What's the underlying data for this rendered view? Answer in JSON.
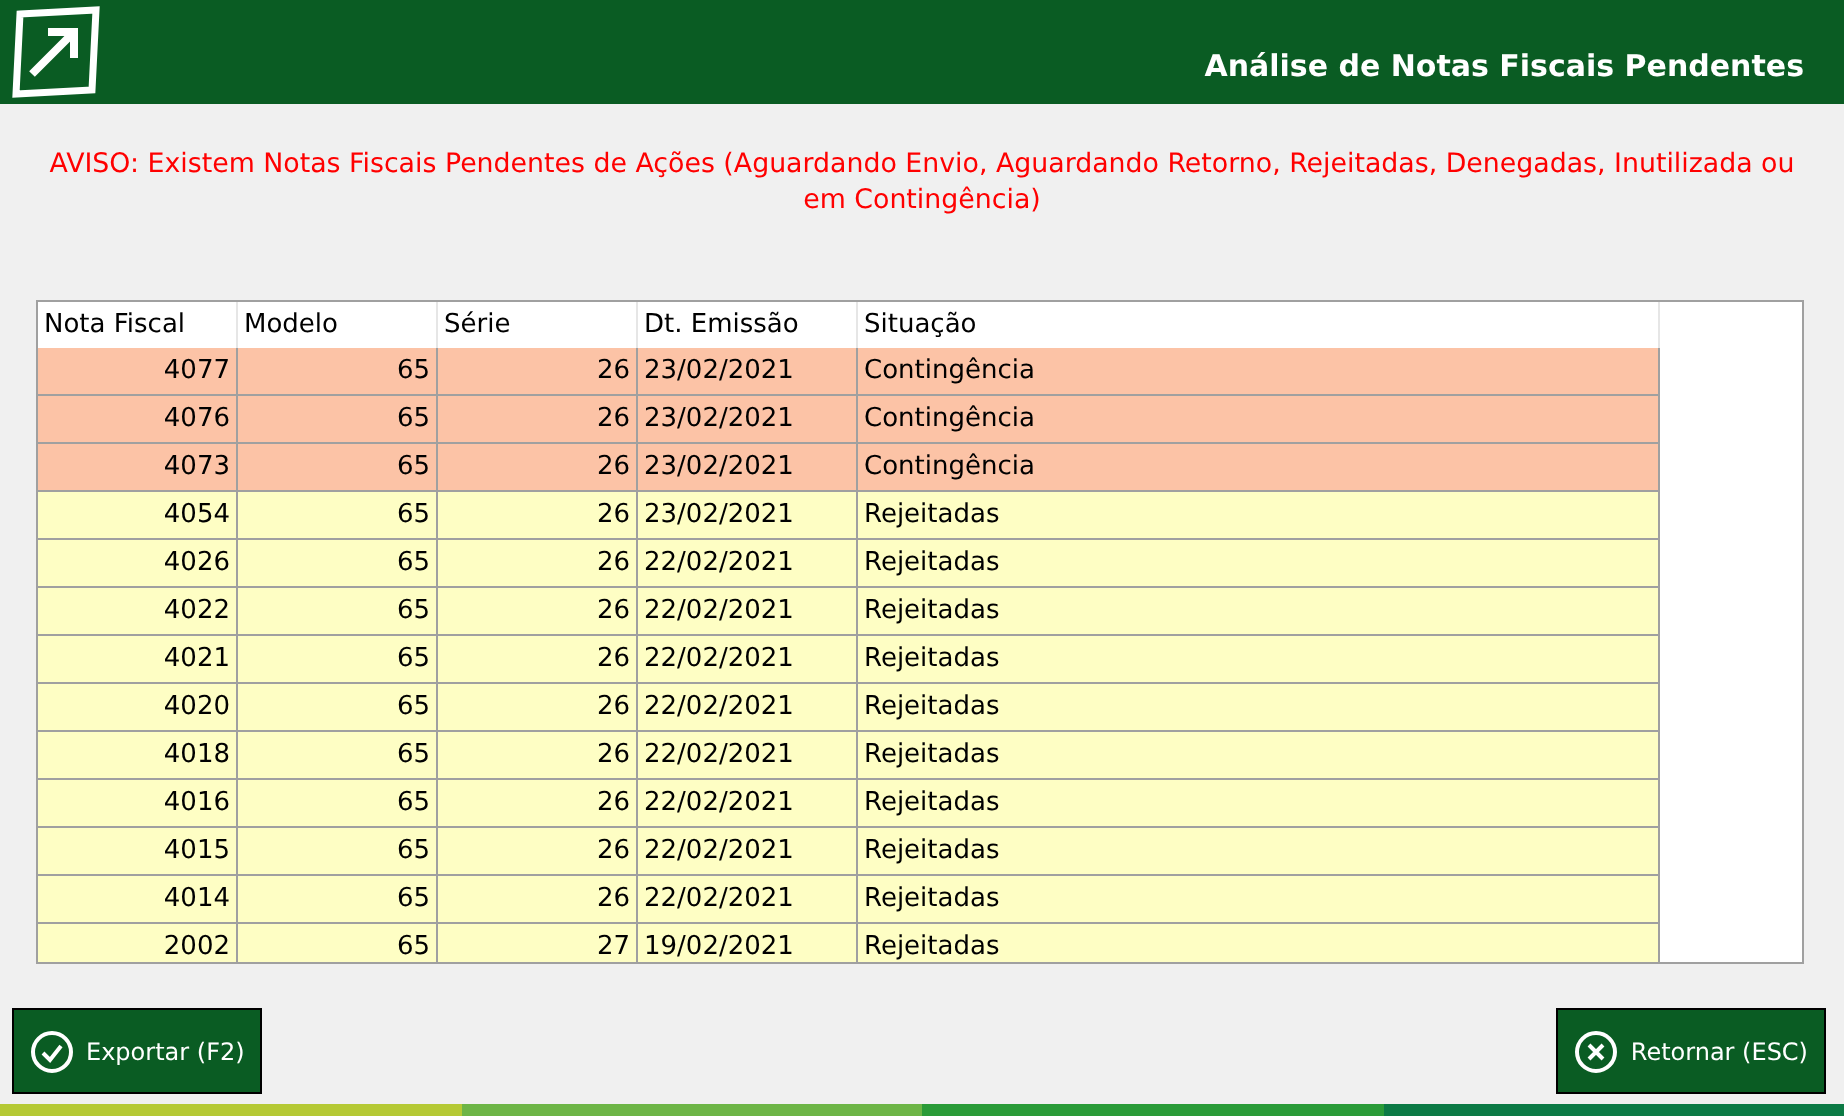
{
  "header": {
    "title": "Análise de Notas Fiscais Pendentes"
  },
  "warning": "AVISO: Existem Notas Fiscais Pendentes de Ações (Aguardando Envio, Aguardando Retorno, Rejeitadas, Denegadas, Inutilizada ou em Contingência)",
  "table": {
    "columns": [
      "Nota Fiscal",
      "Modelo",
      "Série",
      "Dt. Emissão",
      "Situação"
    ],
    "rows": [
      {
        "cells": [
          "4077",
          "65",
          "26",
          "23/02/2021",
          "Contingência"
        ],
        "color": "#fcc3a6"
      },
      {
        "cells": [
          "4076",
          "65",
          "26",
          "23/02/2021",
          "Contingência"
        ],
        "color": "#fcc3a6"
      },
      {
        "cells": [
          "4073",
          "65",
          "26",
          "23/02/2021",
          "Contingência"
        ],
        "color": "#fcc3a6"
      },
      {
        "cells": [
          "4054",
          "65",
          "26",
          "23/02/2021",
          "Rejeitadas"
        ],
        "color": "#fefec4"
      },
      {
        "cells": [
          "4026",
          "65",
          "26",
          "22/02/2021",
          "Rejeitadas"
        ],
        "color": "#fefec4"
      },
      {
        "cells": [
          "4022",
          "65",
          "26",
          "22/02/2021",
          "Rejeitadas"
        ],
        "color": "#fefec4"
      },
      {
        "cells": [
          "4021",
          "65",
          "26",
          "22/02/2021",
          "Rejeitadas"
        ],
        "color": "#fefec4"
      },
      {
        "cells": [
          "4020",
          "65",
          "26",
          "22/02/2021",
          "Rejeitadas"
        ],
        "color": "#fefec4"
      },
      {
        "cells": [
          "4018",
          "65",
          "26",
          "22/02/2021",
          "Rejeitadas"
        ],
        "color": "#fefec4"
      },
      {
        "cells": [
          "4016",
          "65",
          "26",
          "22/02/2021",
          "Rejeitadas"
        ],
        "color": "#fefec4"
      },
      {
        "cells": [
          "4015",
          "65",
          "26",
          "22/02/2021",
          "Rejeitadas"
        ],
        "color": "#fefec4"
      },
      {
        "cells": [
          "4014",
          "65",
          "26",
          "22/02/2021",
          "Rejeitadas"
        ],
        "color": "#fefec4"
      },
      {
        "cells": [
          "2002",
          "65",
          "27",
          "19/02/2021",
          "Rejeitadas"
        ],
        "color": "#fefec4"
      }
    ]
  },
  "buttons": [
    {
      "label": "Exportar (F2)",
      "kind": "check"
    },
    {
      "label": "Retornar (ESC)",
      "kind": "close"
    }
  ]
}
